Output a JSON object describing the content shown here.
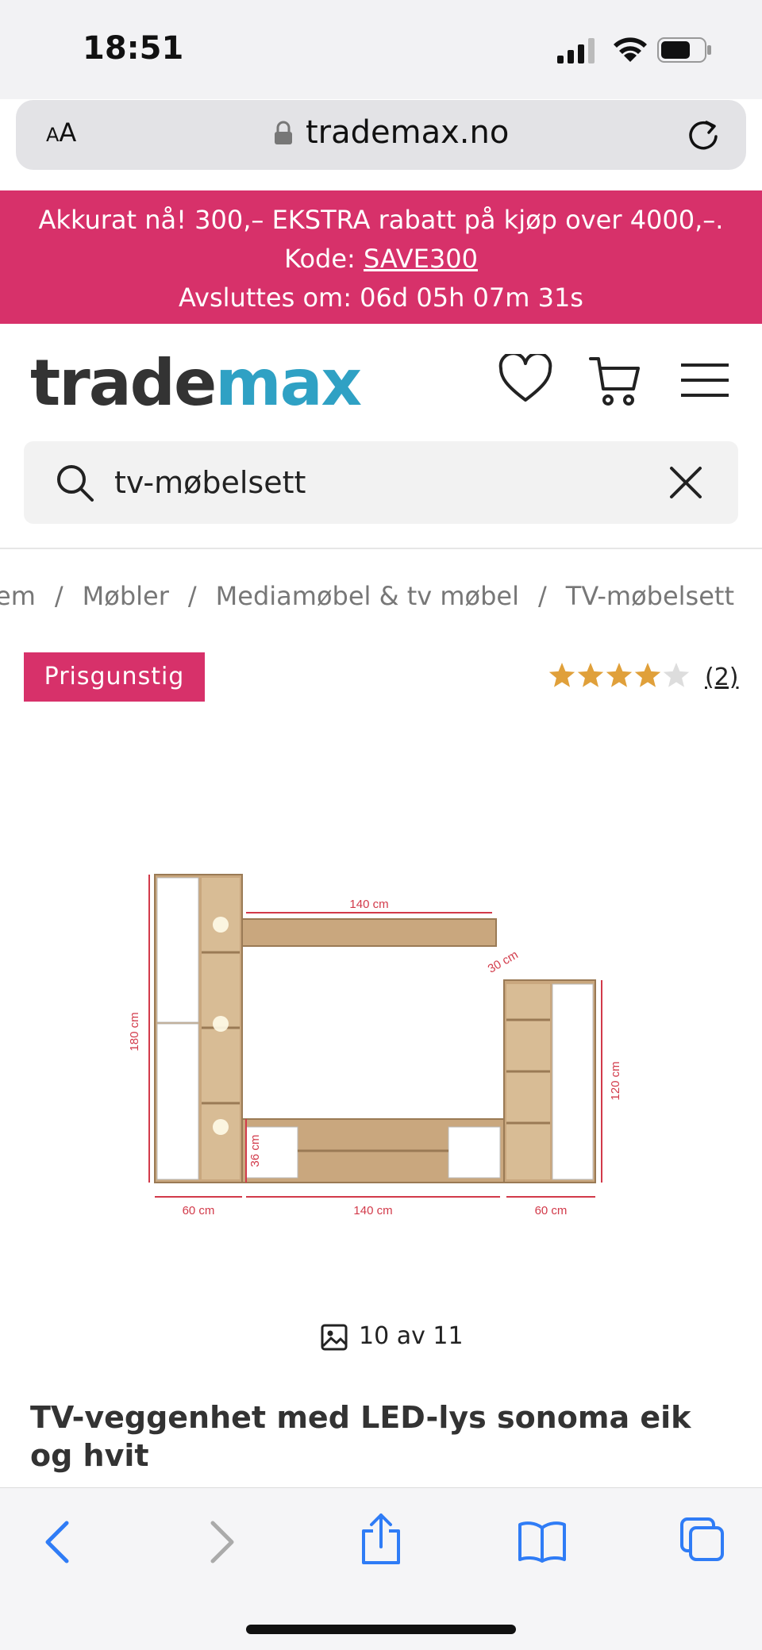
{
  "status_bar": {
    "time": "18:51"
  },
  "address_bar": {
    "text_size_label": "AA",
    "domain": "trademax.no"
  },
  "promo": {
    "line1": "Akkurat nå! 300,– EKSTRA rabatt på kjøp over 4000,–.",
    "code_label": "Kode: ",
    "code": "SAVE300",
    "line3": "Avsluttes om: 06d 05h 07m 31s"
  },
  "header": {
    "logo_part1": "trade",
    "logo_part2": "max"
  },
  "search": {
    "value": "tv-møbelsett"
  },
  "breadcrumb": {
    "items": [
      "em",
      "Møbler",
      "Mediamøbel & tv møbel",
      "TV-møbelsett"
    ],
    "separator": "/"
  },
  "product": {
    "badge": "Prisgunstig",
    "rating": 4,
    "rating_max": 5,
    "review_count": "(2)",
    "gallery_counter": "10 av 11",
    "title": "TV-veggenhet med LED-lys sonoma eik og hvit",
    "dimensions": {
      "left_height": "180 cm",
      "shelf_width": "140 cm",
      "shelf_depth": "30 cm",
      "right_height": "120 cm",
      "low_height": "36 cm",
      "left_width": "60 cm",
      "middle_width": "140 cm",
      "right_width": "60 cm"
    }
  },
  "colors": {
    "brand_pink": "#d7316a",
    "logo_blue": "#2fa1c4",
    "star_gold": "#e0a03a",
    "ios_blue": "#2f7cf6"
  }
}
